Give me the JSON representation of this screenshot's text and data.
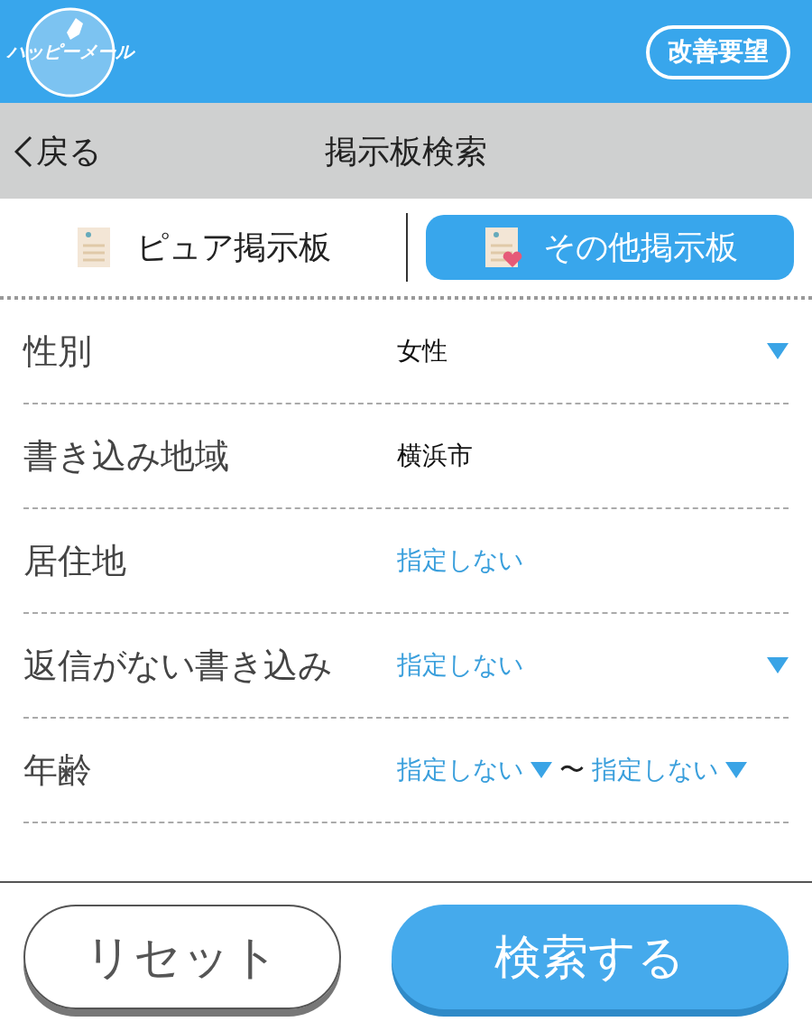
{
  "header": {
    "logo_text": "ハッピーメール",
    "request_button": "改善要望"
  },
  "nav": {
    "back": "戻る",
    "title": "掲示板検索"
  },
  "tabs": [
    {
      "label": "ピュア掲示板",
      "selected": false,
      "kind": "pure"
    },
    {
      "label": "その他掲示板",
      "selected": true,
      "kind": "other"
    }
  ],
  "rows": [
    {
      "label": "性別",
      "kind": "select",
      "values": [
        {
          "text": "女性",
          "unset": false
        }
      ]
    },
    {
      "label": "書き込み地域",
      "kind": "input",
      "values": [
        {
          "text": "横浜市",
          "unset": false
        }
      ]
    },
    {
      "label": "居住地",
      "kind": "input",
      "values": [
        {
          "text": "指定しない",
          "unset": true
        }
      ]
    },
    {
      "label": "返信がない書き込み",
      "kind": "select",
      "values": [
        {
          "text": "指定しない",
          "unset": true
        }
      ]
    },
    {
      "label": "年齢",
      "kind": "range",
      "separator": "〜",
      "values": [
        {
          "text": "指定しない",
          "unset": true
        },
        {
          "text": "指定しない",
          "unset": true
        }
      ]
    }
  ],
  "footer": {
    "reset_button": "リセット",
    "search_button": "検索する"
  }
}
